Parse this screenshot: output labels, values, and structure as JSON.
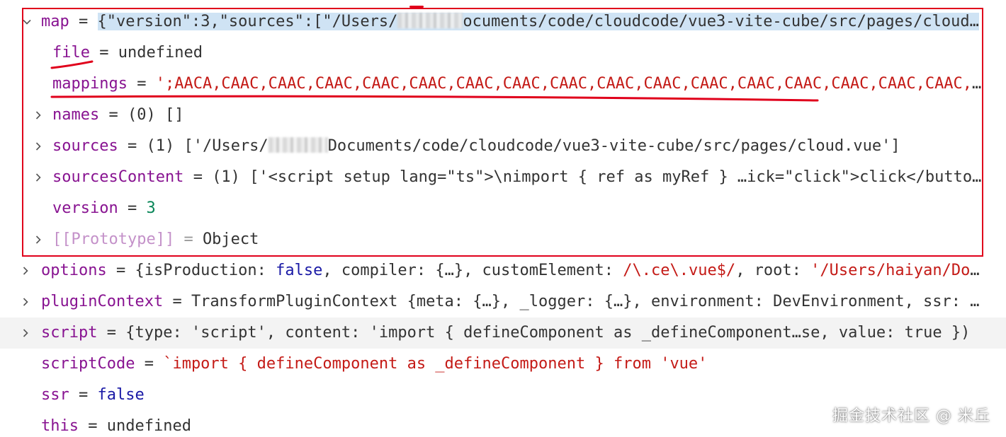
{
  "colors": {
    "key": "#881391",
    "key_dim": "#c491c9",
    "string": "#c41a16",
    "number": "#098658",
    "keyword": "#1a1aa6",
    "text": "#333333",
    "selection": "#cfe3f4",
    "annotation_red": "#e0001b",
    "row_highlight": "#f3f3f3"
  },
  "rows": {
    "map": {
      "key": "map",
      "eq": "=",
      "value_prefix": "{\"version\":3,\"sources\":[\"/Users/",
      "value_suffix": "ocuments/code/cloudcode/vue3-vite-cube/src/pages/cloud…"
    },
    "file": {
      "key": "file",
      "eq": "=",
      "value": "undefined"
    },
    "mappings": {
      "key": "mappings",
      "eq": "=",
      "value": "';AACA,CAAC,CAAC,CAAC,CAAC,CAAC,CAAC,CAAC,CAAC,CAAC,CAAC,CAAC,CAAC,CAAC,CAAC,CAAC,CAAC,C…"
    },
    "names": {
      "key": "names",
      "eq": "=",
      "value": "(0) []"
    },
    "sources": {
      "key": "sources",
      "eq": "=",
      "count": "(1)",
      "value_prefix": "['/Users/",
      "value_suffix": "Documents/code/cloudcode/vue3-vite-cube/src/pages/cloud.vue']"
    },
    "sourcesContent": {
      "key": "sourcesContent",
      "eq": "=",
      "count": "(1)",
      "value": "['<script setup lang=\"ts\">\\nimport { ref as myRef } …ick=\"click\">click</button…"
    },
    "version": {
      "key": "version",
      "eq": "=",
      "value": "3"
    },
    "prototype": {
      "key": "[[Prototype]]",
      "eq": "=",
      "value": "Object"
    },
    "options": {
      "key": "options",
      "eq": "=",
      "value_a": "{isProduction: ",
      "value_b": "false",
      "value_c": ", compiler: {…}, customElement: ",
      "value_d": "/\\.ce\\.vue$/",
      "value_e": ", root: ",
      "value_f": "'/Users/haiyan/Doc…"
    },
    "pluginContext": {
      "key": "pluginContext",
      "eq": "=",
      "value": "TransformPluginContext {meta: {…}, _logger: {…}, environment: DevEnvironment, ssr: f…"
    },
    "script": {
      "key": "script",
      "eq": "=",
      "value_a": "{type: ",
      "value_b": "'script'",
      "value_c": ", content: ",
      "value_d": "'import { defineComponent as _defineComponent…se",
      "value_e": ", value: ",
      "value_f": "true",
      "value_g": " })"
    },
    "scriptCode": {
      "key": "scriptCode",
      "eq": "=",
      "value": "`import { defineComponent as _defineComponent } from 'vue'"
    },
    "ssr": {
      "key": "ssr",
      "eq": "=",
      "value": "false"
    },
    "this": {
      "key": "this",
      "eq": "=",
      "value": "undefined"
    }
  },
  "icons": {
    "expanded": "chevron-down-icon",
    "collapsed": "chevron-right-icon"
  },
  "watermark": "掘金技术社区 @ 米丘"
}
